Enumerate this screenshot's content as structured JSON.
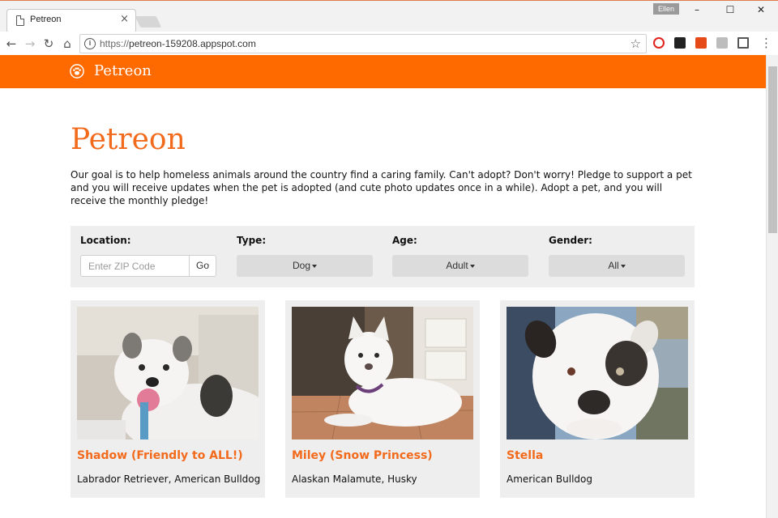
{
  "browser": {
    "tab_title": "Petreon",
    "tab_close": "×",
    "profile_name": "Ellen",
    "url_scheme": "https://",
    "url_host": "petreon-159208.appspot.com",
    "window_controls": {
      "minimize": "–",
      "maximize": "☐",
      "close": "✕"
    },
    "nav": {
      "back": "←",
      "forward": "→",
      "reload": "↻",
      "home": "⌂"
    },
    "bookmark_star": "☆",
    "menu": "⋮",
    "extensions": [
      {
        "name": "opera-extension-icon",
        "color": "#e0221b"
      },
      {
        "name": "jd-extension-icon",
        "color": "#222222"
      },
      {
        "name": "office-extension-icon",
        "color": "#e64a19"
      },
      {
        "name": "kanji-extension-icon",
        "color": "#9e9e9e"
      },
      {
        "name": "cast-icon",
        "color": "#555555"
      }
    ]
  },
  "site": {
    "brand": "Petreon",
    "accent_color": "#ff6a00",
    "title": "Petreon",
    "intro": "Our goal is to help homeless animals around the country find a caring family. Can't adopt? Don't worry! Pledge to support a pet and you will receive updates when the pet is adopted (and cute photo updates once in a while). Adopt a pet, and you will receive the monthly pledge!"
  },
  "filters": {
    "location": {
      "label": "Location:",
      "placeholder": "Enter ZIP Code",
      "button": "Go"
    },
    "type": {
      "label": "Type:",
      "value": "Dog"
    },
    "age": {
      "label": "Age:",
      "value": "Adult"
    },
    "gender": {
      "label": "Gender:",
      "value": "All"
    }
  },
  "pets": [
    {
      "name": "Shadow (Friendly to ALL!)",
      "breed": "Labrador Retriever, American Bulldog"
    },
    {
      "name": "Miley (Snow Princess)",
      "breed": "Alaskan Malamute, Husky"
    },
    {
      "name": "Stella",
      "breed": "American Bulldog"
    }
  ]
}
